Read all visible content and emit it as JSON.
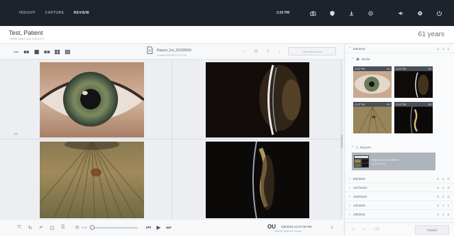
{
  "topbar": {
    "nav": [
      "INSIGHT",
      "CAPTURE",
      "REVIEW"
    ],
    "active_index": 2,
    "time": "3:25 PM",
    "icons": [
      "camera-icon",
      "shield-icon",
      "download-icon",
      "gear-outline-icon",
      "volume-icon",
      "settings-icon",
      "power-icon"
    ]
  },
  "patient": {
    "name": "Test, Patient",
    "meta": "TURN 9483 401   5/3/1977",
    "age": "61 years"
  },
  "toolbar": {
    "report_title": "Report_2ut_20230509",
    "report_sub": "Created 5/9/2023 12:07 PM",
    "action_button": "Generate report"
  },
  "viewer": {
    "cells": [
      {
        "name": "eye-front",
        "badge": "OD"
      },
      {
        "name": "slit-lamp",
        "badge": ""
      },
      {
        "name": "iris-detail",
        "badge": ""
      },
      {
        "name": "lens-section",
        "badge": ""
      }
    ]
  },
  "bottombar": {
    "zoom_label": "1:00",
    "zoom_level": 0.0,
    "eye": "OU",
    "date": "5/9/2023  12:07:00 PM",
    "sub": "Anterior Segment Images"
  },
  "side": {
    "sessions": [
      {
        "date": "5/9/2023",
        "counts": [
          "4",
          "1",
          "1"
        ],
        "expanded": true
      },
      {
        "date": "5/5/2023",
        "counts": [
          "0",
          "1",
          "0"
        ],
        "expanded": false
      },
      {
        "date": "4/27/2023",
        "counts": [
          "0",
          "1",
          "0"
        ],
        "expanded": false
      },
      {
        "date": "4/26/2023",
        "counts": [
          "0",
          "1",
          "0"
        ],
        "expanded": false
      },
      {
        "date": "4/5/2023",
        "counts": [
          "0",
          "1",
          "1"
        ],
        "expanded": false
      },
      {
        "date": "3/9/2023",
        "counts": [
          "0",
          "1",
          "0"
        ],
        "expanded": false
      }
    ],
    "media_label": "Media",
    "reports_label": "Reports",
    "thumbs": [
      {
        "time": "12:07 PM",
        "eye": "OD"
      },
      {
        "time": "12:07 PM",
        "eye": "OS"
      },
      {
        "time": "12:07 PM",
        "eye": "OD"
      },
      {
        "time": "12:07 PM",
        "eye": "OS"
      }
    ],
    "report_item": {
      "title": "Report_2ut_20230509",
      "sub": "12:07:22 PM"
    },
    "publish_label": "Publish"
  }
}
